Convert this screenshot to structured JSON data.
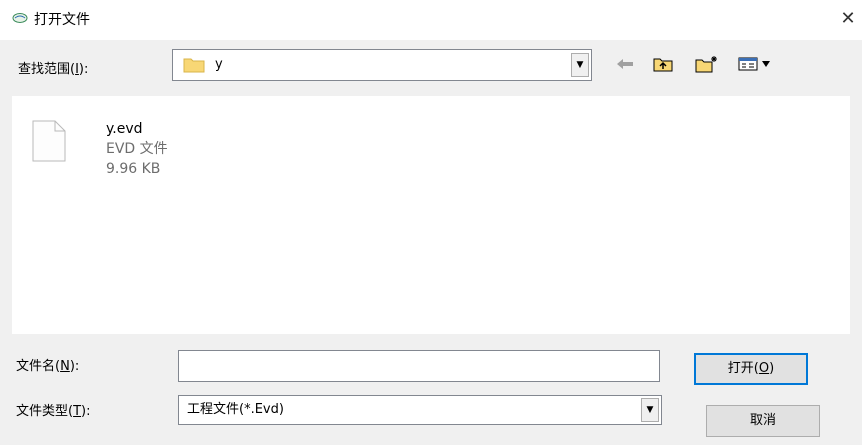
{
  "window": {
    "title": "打开文件",
    "close_glyph": "✕"
  },
  "look_in": {
    "label_prefix": "查找范围(",
    "label_key": "I",
    "label_suffix": "):",
    "value": "y"
  },
  "toolbar": {
    "back_icon": "back-arrow-icon",
    "up_icon": "up-folder-icon",
    "new_folder_icon": "new-folder-icon",
    "view_icon": "view-menu-icon"
  },
  "files": [
    {
      "name": "y.evd",
      "type": "EVD 文件",
      "size": "9.96 KB"
    }
  ],
  "file_name": {
    "label_prefix": "文件名(",
    "label_key": "N",
    "label_suffix": "):",
    "value": ""
  },
  "file_type": {
    "label_prefix": "文件类型(",
    "label_key": "T",
    "label_suffix": "):",
    "value": "工程文件(*.Evd)"
  },
  "buttons": {
    "open_prefix": "打开(",
    "open_key": "O",
    "open_suffix": ")",
    "cancel": "取消"
  },
  "colors": {
    "accent": "#0078d7",
    "folder": "#f8d775",
    "window_bg": "#f0f0f0"
  }
}
